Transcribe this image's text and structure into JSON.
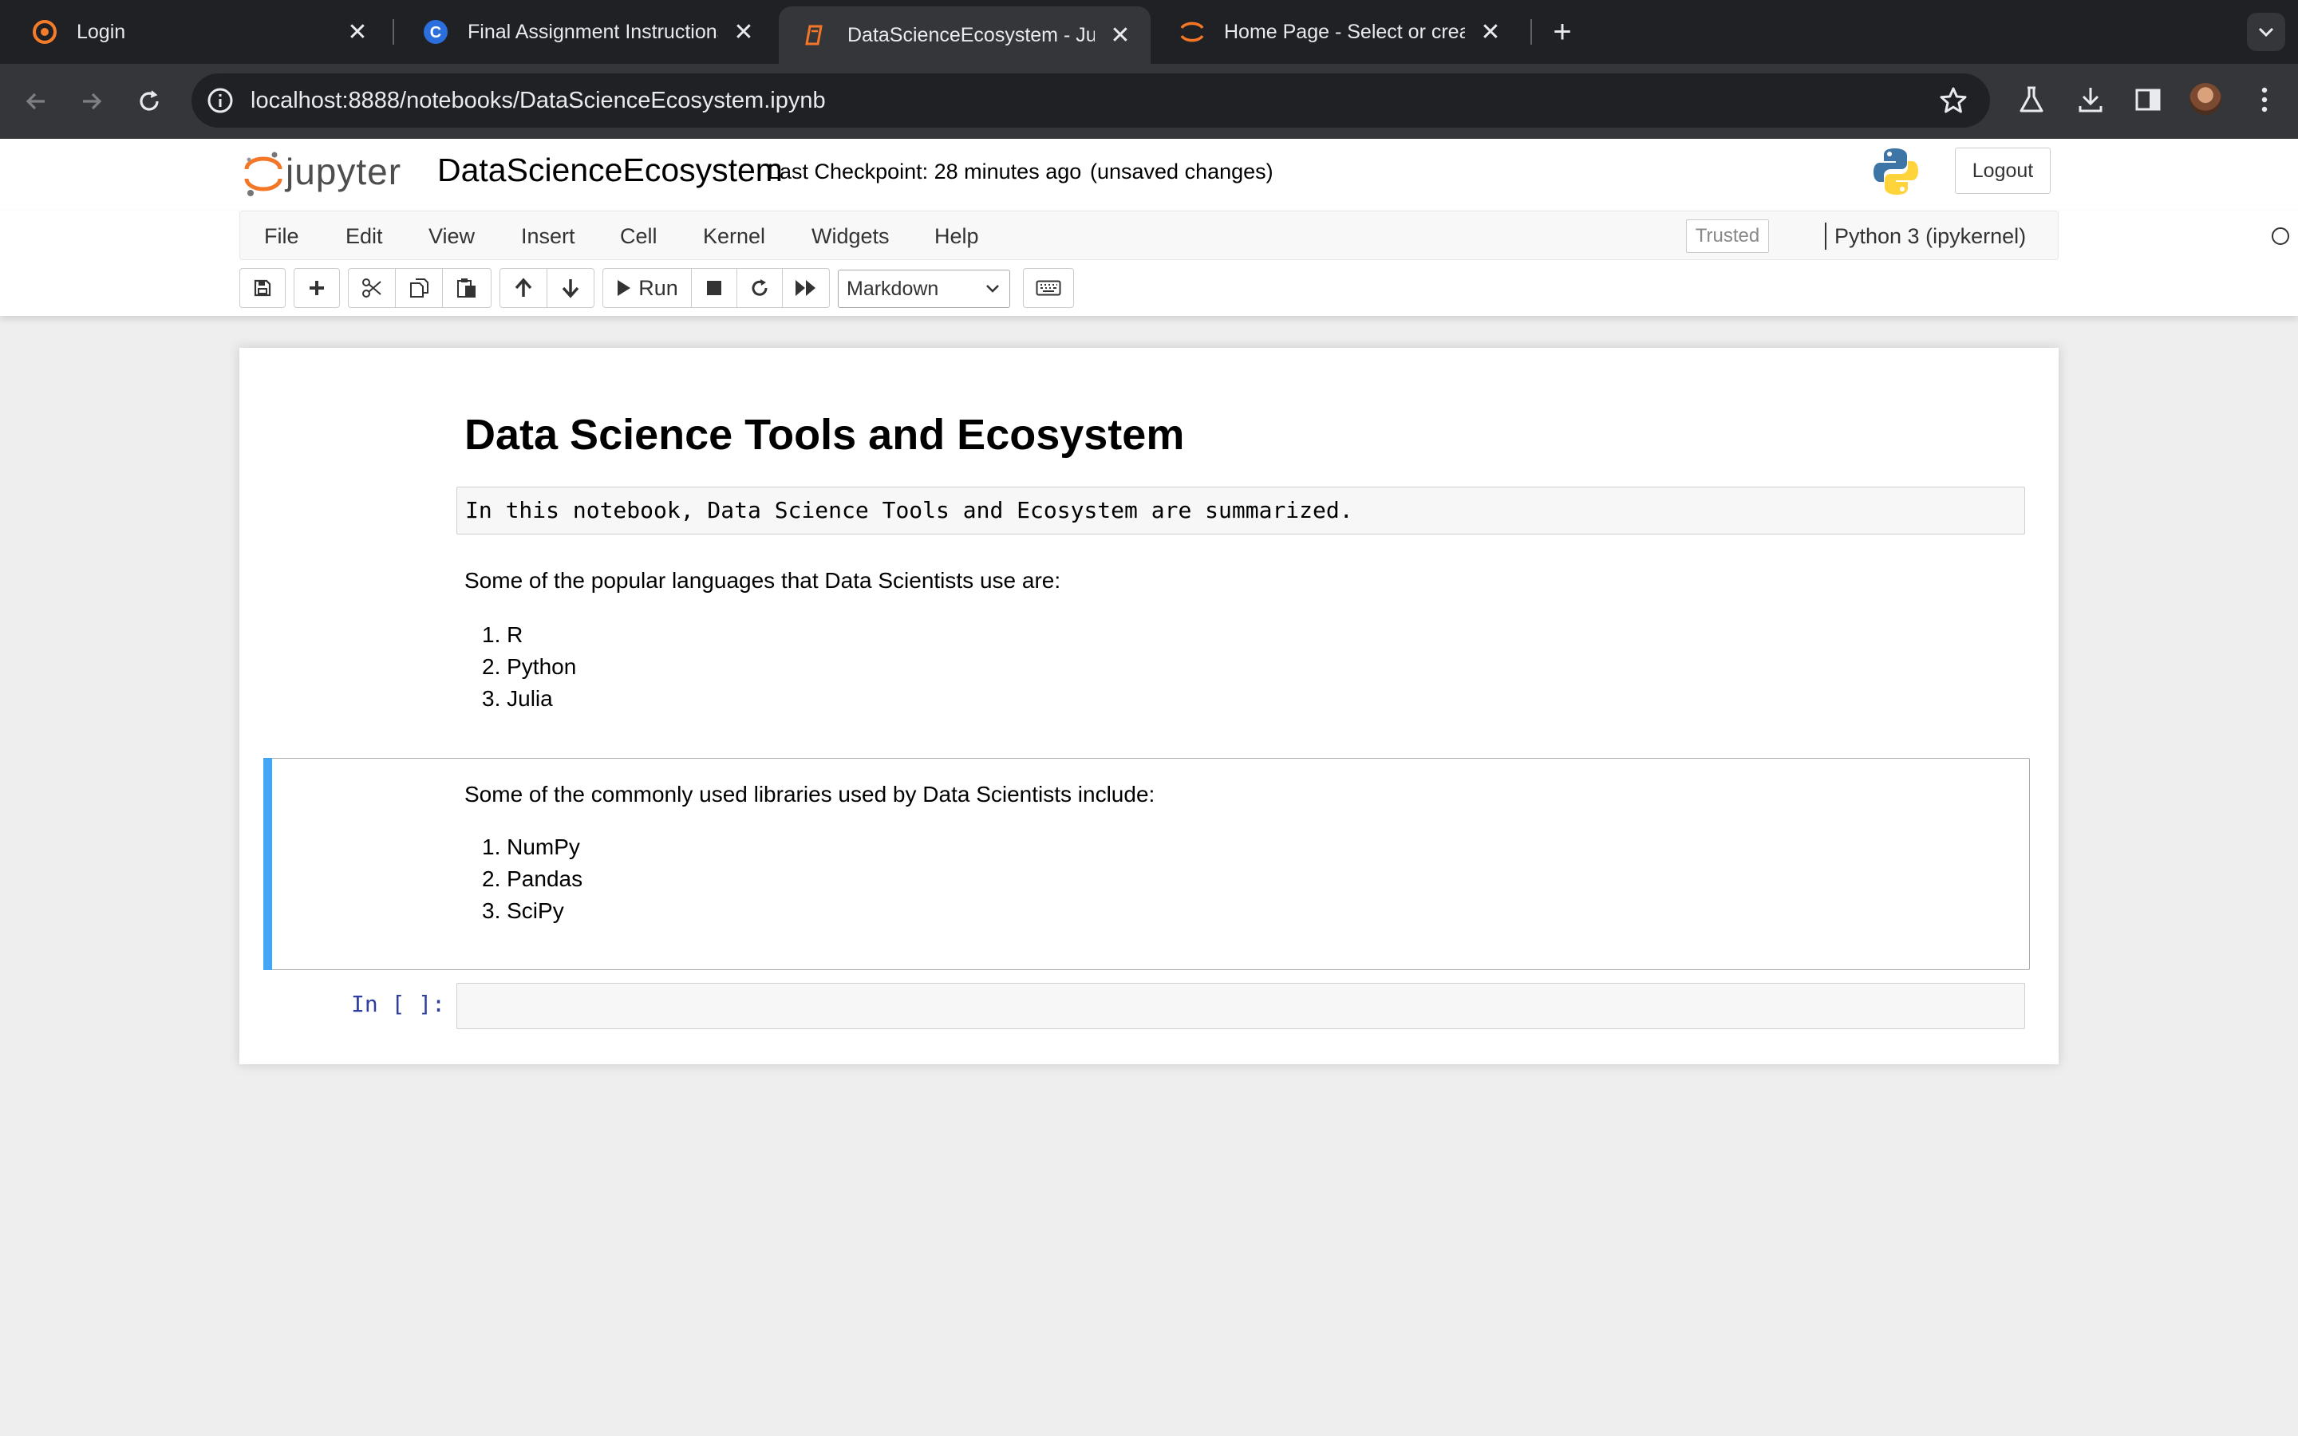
{
  "browser": {
    "tabs": [
      {
        "title": "Login",
        "icon": "coursera-logo-icon"
      },
      {
        "title": "Final Assignment Instructions",
        "icon": "coursera-c-icon"
      },
      {
        "title": "DataScienceEcosystem - Jupyter Notebook",
        "icon": "notebook-icon"
      },
      {
        "title": "Home Page - Select or create a notebook",
        "icon": "jupyter-spinner-icon"
      }
    ],
    "active_tab": 2,
    "url": "localhost:8888/notebooks/DataScienceEcosystem.ipynb",
    "colors": {
      "tabstrip": "#202124",
      "toolbar": "#35363a"
    }
  },
  "jupyter": {
    "logo_text": "jupyter",
    "notebook_name": "DataScienceEcosystem",
    "checkpoint": "Last Checkpoint: 28 minutes ago",
    "save_status": "(unsaved changes)",
    "logout_label": "Logout",
    "menu": [
      "File",
      "Edit",
      "View",
      "Insert",
      "Cell",
      "Kernel",
      "Widgets",
      "Help"
    ],
    "trusted_label": "Trusted",
    "kernel_name": "Python 3 (ipykernel)",
    "toolbar": {
      "buttons": [
        "save-icon",
        "plus-icon",
        "cut-icon",
        "copy-icon",
        "paste-icon",
        "arrow-up-icon",
        "arrow-down-icon",
        "run-icon",
        "stop-icon",
        "restart-icon",
        "fast-forward-icon",
        "keyboard-icon"
      ],
      "run_label": "Run",
      "cell_type": "Markdown"
    }
  },
  "notebook": {
    "title": "Data Science Tools and Ecosystem",
    "summary": "In this notebook, Data Science Tools and Ecosystem are summarized.",
    "languages_intro": "Some of the popular languages that Data Scientists use are:",
    "languages": [
      "1. R",
      "2. Python",
      "3. Julia"
    ],
    "libraries_intro": "Some of the commonly used libraries used by Data Scientists include:",
    "libraries": [
      "1. NumPy",
      "2. Pandas",
      "3. SciPy"
    ],
    "input_prompt": "In [ ]:",
    "selected_cell_color": "#42a5f5"
  }
}
